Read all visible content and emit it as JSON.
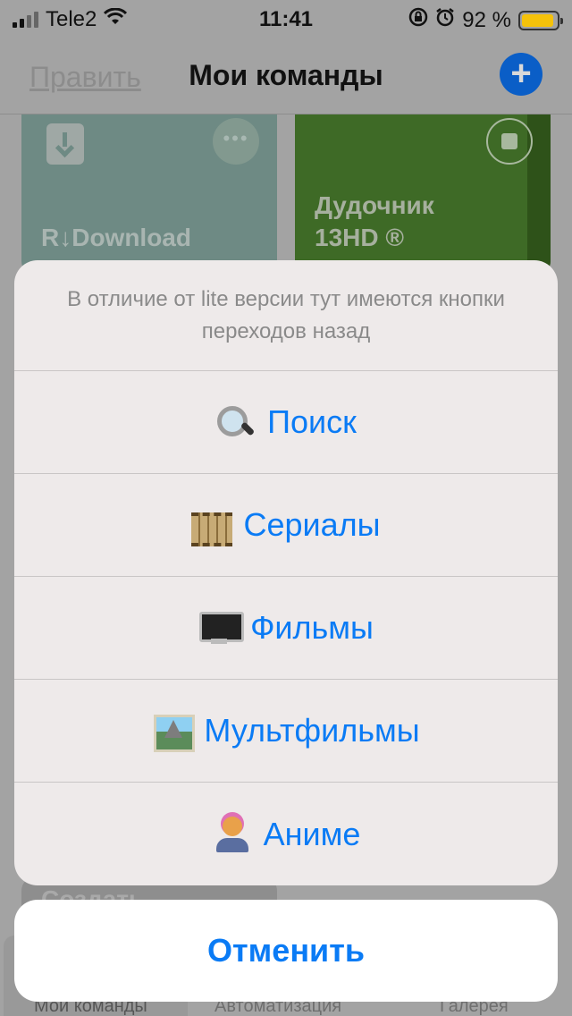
{
  "status_bar": {
    "carrier": "Tele2",
    "time": "11:41",
    "battery": "92 %",
    "battery_level": 0.92
  },
  "nav": {
    "edit_label": "Править",
    "title": "Мои команды",
    "add_icon": "plus-icon"
  },
  "shortcuts": [
    {
      "name": "R↓Download",
      "icon": "download-icon",
      "color": "#6e8a84"
    },
    {
      "name_line1": "Дудочник",
      "name_line2": "13HD ®",
      "icon": "stop-icon",
      "color": "#3e6a26"
    },
    {
      "name": "Создать"
    }
  ],
  "tabbar": {
    "tabs": [
      {
        "label": "Мои команды"
      },
      {
        "label": "Автоматизация"
      },
      {
        "label": "Галерея"
      }
    ]
  },
  "action_sheet": {
    "message": "В отличие от lite версии тут имеются кнопки переходов назад",
    "options": [
      {
        "label": "Поиск",
        "emoji": "magnifier"
      },
      {
        "label": "Сериалы",
        "emoji": "film-frames"
      },
      {
        "label": "Фильмы",
        "emoji": "desktop-computer"
      },
      {
        "label": "Мультфильмы",
        "emoji": "framed-picture"
      },
      {
        "label": "Аниме",
        "emoji": "person-with-pink-hair"
      }
    ],
    "cancel_label": "Отменить"
  },
  "colors": {
    "accent": "#0a7bf5",
    "sheet_bg": "#eeeaea",
    "battery_fill": "#f5c20a"
  }
}
